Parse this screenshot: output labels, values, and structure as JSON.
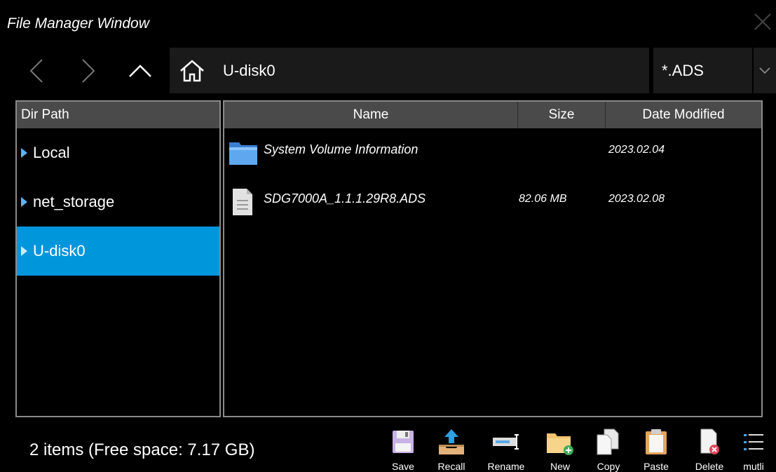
{
  "window": {
    "title": "File Manager Window"
  },
  "nav": {
    "current_path": "U-disk0",
    "filter": "*.ADS"
  },
  "dir_pane": {
    "header": "Dir Path",
    "items": [
      {
        "label": "Local"
      },
      {
        "label": "net_storage"
      },
      {
        "label": "U-disk0",
        "selected": true
      }
    ]
  },
  "file_pane": {
    "columns": {
      "name": "Name",
      "size": "Size",
      "date": "Date Modified"
    },
    "rows": [
      {
        "type": "folder",
        "name": "System Volume Information",
        "size": "",
        "date": "2023.02.04"
      },
      {
        "type": "file",
        "name": "SDG7000A_1.1.1.29R8.ADS",
        "size": "82.06 MB",
        "date": "2023.02.08"
      }
    ]
  },
  "status": {
    "text": "2 items (Free space: 7.17 GB)"
  },
  "toolbar": {
    "save": "Save",
    "recall": "Recall",
    "rename": "Rename",
    "new": "New",
    "copy": "Copy",
    "paste": "Paste",
    "delete": "Delete",
    "multi": "mutli"
  },
  "colors": {
    "selected_bg": "#0096dc",
    "header_bg": "#4a4a4a",
    "background": "#000000"
  }
}
